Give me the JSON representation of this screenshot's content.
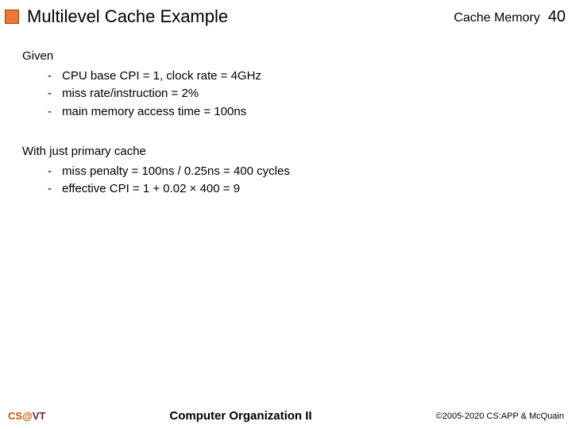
{
  "header": {
    "title": "Multilevel Cache Example",
    "topic": "Cache Memory",
    "slide_number": "40"
  },
  "sections": {
    "given": {
      "heading": "Given",
      "items": [
        "CPU base CPI = 1, clock rate = 4GHz",
        "miss rate/instruction = 2%",
        "main memory access time = 100ns"
      ]
    },
    "primary": {
      "heading": "With just primary cache",
      "items": [
        "miss penalty = 100ns / 0.25ns = 400 cycles",
        "effective CPI = 1 + 0.02 × 400 = 9"
      ]
    }
  },
  "footer": {
    "left_cs": "CS",
    "left_at": "@",
    "left_vt": "VT",
    "center": "Computer Organization II",
    "right": "©2005-2020 CS:APP & McQuain"
  }
}
